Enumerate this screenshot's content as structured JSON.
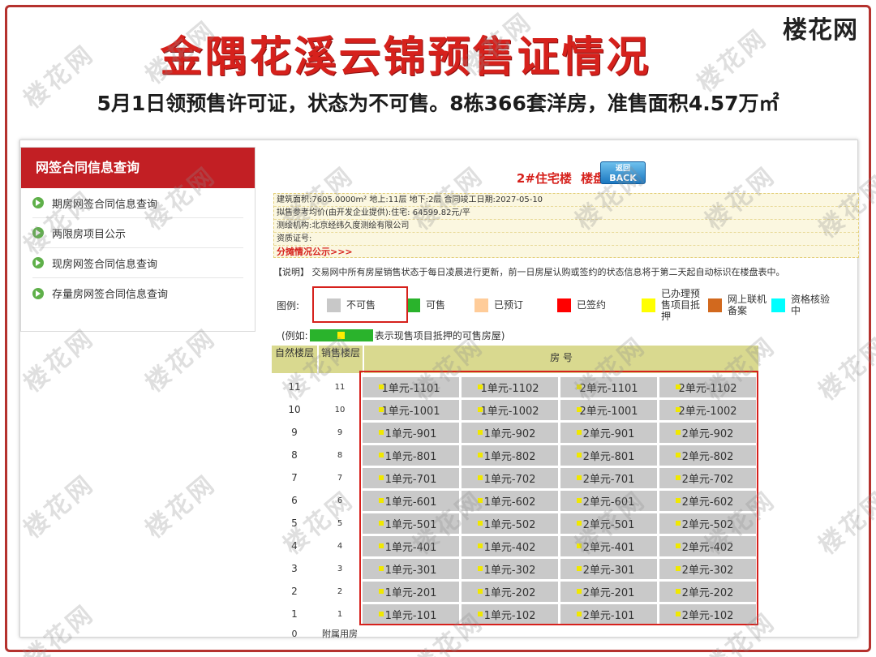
{
  "logo": "楼花网",
  "title": "金隅花溪云锦预售证情况",
  "subtitle": "5月1日领预售许可证，状态为不可售。8栋366套洋房，准售面积4.57万㎡",
  "sidebar": {
    "header": "网签合同信息查询",
    "items": [
      "期房网签合同信息查询",
      "两限房项目公示",
      "现房网签合同信息查询",
      "存量房网签合同信息查询"
    ]
  },
  "building": {
    "title": "2#住宅楼",
    "subtitle": "楼盘表",
    "back_label": "返回",
    "back_sub": "BACK",
    "info": {
      "line1": "建筑面积:7605.0000m² 地上:11层 地下:2层 合同竣工日期:2027-05-10",
      "line2": "拟售参考均价(由开发企业提供):住宅: 64599.82元/平",
      "line3": "测绘机构:北京经纬久度测绘有限公司",
      "line4": "资质证号:",
      "link": "分摊情况公示>>>"
    },
    "note": "【说明】 交易网中所有房屋销售状态于每日凌晨进行更新，前一日房屋认购或签约的状态信息将于第二天起自动标识在楼盘表中。"
  },
  "legend": {
    "label": "图例:",
    "items": [
      {
        "label": "不可售",
        "color": "#c8c8c8"
      },
      {
        "label": "可售",
        "color": "#2ab32c"
      },
      {
        "label": "已预订",
        "color": "#ffcc99"
      },
      {
        "label": "已签约",
        "color": "#ff0000"
      },
      {
        "label": "已办理预售项目抵押",
        "color": "#ffff00"
      },
      {
        "label": "网上联机备案",
        "color": "#d2691e"
      },
      {
        "label": "资格核验中",
        "color": "#00ffff"
      }
    ],
    "example_prefix": "(例如:",
    "example_suffix": "表示现售项目抵押的可售房屋)"
  },
  "table": {
    "head_floor": "自然楼层",
    "head_sale": "销售楼层",
    "head_room": "房 号",
    "rows": [
      {
        "floor": "11",
        "sale": "11",
        "rooms": [
          "1单元-1101",
          "1单元-1102",
          "2单元-1101",
          "2单元-1102"
        ]
      },
      {
        "floor": "10",
        "sale": "10",
        "rooms": [
          "1单元-1001",
          "1单元-1002",
          "2单元-1001",
          "2单元-1002"
        ]
      },
      {
        "floor": "9",
        "sale": "9",
        "rooms": [
          "1单元-901",
          "1单元-902",
          "2单元-901",
          "2单元-902"
        ]
      },
      {
        "floor": "8",
        "sale": "8",
        "rooms": [
          "1单元-801",
          "1单元-802",
          "2单元-801",
          "2单元-802"
        ]
      },
      {
        "floor": "7",
        "sale": "7",
        "rooms": [
          "1单元-701",
          "1单元-702",
          "2单元-701",
          "2单元-702"
        ]
      },
      {
        "floor": "6",
        "sale": "6",
        "rooms": [
          "1单元-601",
          "1单元-602",
          "2单元-601",
          "2单元-602"
        ]
      },
      {
        "floor": "5",
        "sale": "5",
        "rooms": [
          "1单元-501",
          "1单元-502",
          "2单元-501",
          "2单元-502"
        ]
      },
      {
        "floor": "4",
        "sale": "4",
        "rooms": [
          "1单元-401",
          "1单元-402",
          "2单元-401",
          "2单元-402"
        ]
      },
      {
        "floor": "3",
        "sale": "3",
        "rooms": [
          "1单元-301",
          "1单元-302",
          "2单元-301",
          "2单元-302"
        ]
      },
      {
        "floor": "2",
        "sale": "2",
        "rooms": [
          "1单元-201",
          "1单元-202",
          "2单元-201",
          "2单元-202"
        ]
      },
      {
        "floor": "1",
        "sale": "1",
        "rooms": [
          "1单元-101",
          "1单元-102",
          "2单元-101",
          "2单元-102"
        ]
      }
    ],
    "base_floor": "0",
    "base_sale": "附属用房"
  }
}
